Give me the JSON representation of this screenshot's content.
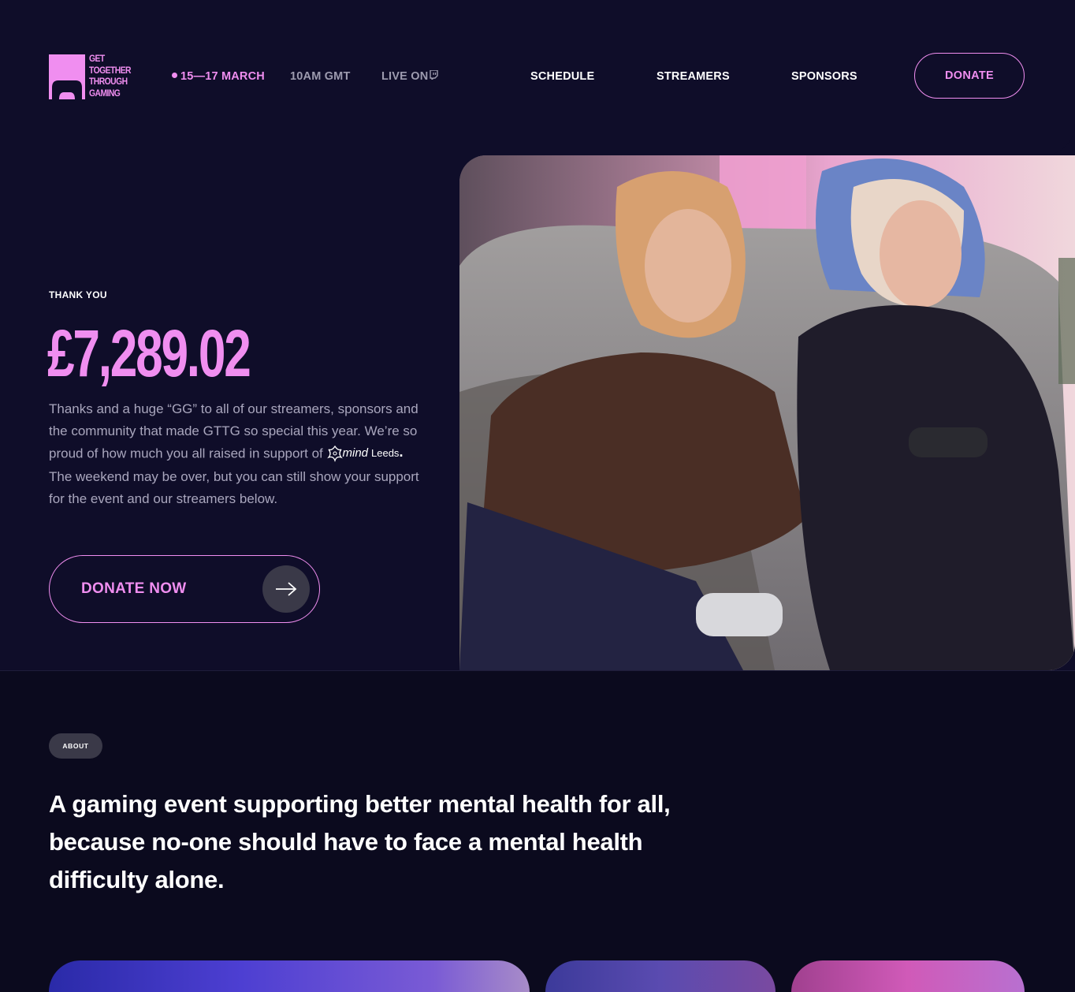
{
  "brand": {
    "logo_lines": [
      "GET",
      "TOGETHER",
      "THROUGH",
      "GAMING"
    ],
    "accent": "#f08ef0",
    "background": "#0f0d29"
  },
  "event": {
    "dates": "15—17 MARCH",
    "time": "10AM GMT",
    "live_on": "LIVE ON",
    "live_icon": "twitch-icon"
  },
  "nav": {
    "schedule": "SCHEDULE",
    "streamers": "STREAMERS",
    "sponsors": "SPONSORS",
    "donate": "DONATE"
  },
  "hero": {
    "eyebrow": "THANK YOU",
    "total": "£7,289.02",
    "intro_before": "Thanks and a huge “GG” to all of our streamers, sponsors and the community that made GTTG so special this year. We’re so proud of how much you all raised in support of",
    "charity_name": "mind",
    "charity_location": "Leeds",
    "intro_after": "The weekend may be over, but you can still show your support for the event and our streamers below.",
    "cta_label": "DONATE NOW",
    "cta_icon": "arrow-right-icon"
  },
  "about": {
    "pill": "ABOUT",
    "statement": "A gaming event supporting better mental health for all, because no-one should have to face a mental health difficulty alone."
  }
}
